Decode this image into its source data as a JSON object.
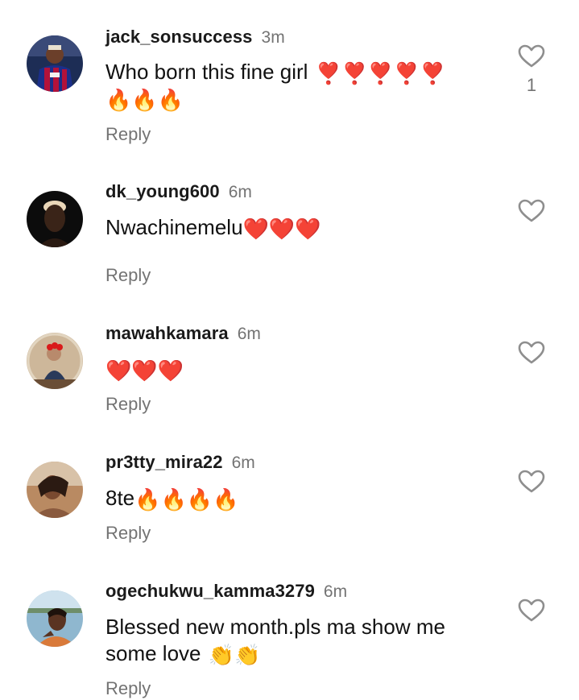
{
  "comments": [
    {
      "username": "jack_sonsuccess",
      "time": "3m",
      "text": "Who born this fine girl",
      "emoji_line1": "❣️❣️❣️❣️❣️",
      "emoji_line2": "🔥🔥🔥",
      "reply_label": "Reply",
      "like_count": "1",
      "avatar_icon": "football-player-avatar"
    },
    {
      "username": "dk_young600",
      "time": "6m",
      "text": "Nwachinemelu",
      "emoji": "❤️❤️❤️",
      "reply_label": "Reply",
      "avatar_icon": "portrait-avatar"
    },
    {
      "username": "mawahkamara",
      "time": "6m",
      "text": "",
      "emoji": "❤️❤️❤️",
      "reply_label": "Reply",
      "avatar_icon": "baby-photo-avatar"
    },
    {
      "username": "pr3tty_mira22",
      "time": "6m",
      "text": "8te",
      "emoji": "🔥🔥🔥🔥",
      "reply_label": "Reply",
      "avatar_icon": "selfie-avatar"
    },
    {
      "username": "ogechukwu_kamma3279",
      "time": "6m",
      "text": "Blessed new month.pls ma show me",
      "text_line2": "some love",
      "emoji": "👏👏",
      "reply_label": "Reply",
      "avatar_icon": "selfie-avatar"
    }
  ],
  "colors": {
    "text": "#111111",
    "muted": "#737373",
    "heart_emoji": "#e0161f",
    "fire_emoji": "#ff7a00"
  },
  "icons": {
    "like": "heart-outline-icon"
  }
}
